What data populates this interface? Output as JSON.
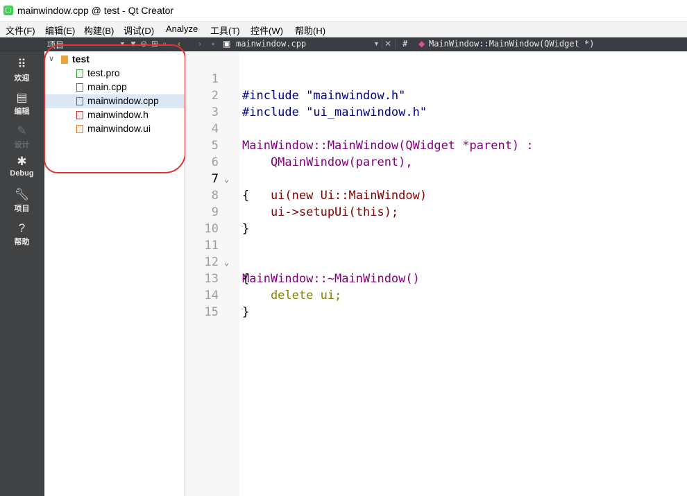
{
  "window": {
    "title": "mainwindow.cpp @ test - Qt Creator"
  },
  "menu": [
    "文件(F)",
    "编辑(E)",
    "构建(B)",
    "调试(D)",
    "Analyze",
    "工具(T)",
    "控件(W)",
    "帮助(H)"
  ],
  "toolbar": {
    "pane_label": "项目",
    "file_name": "mainwindow.cpp",
    "hash": "#",
    "symbol": "MainWindow::MainWindow(QWidget *)"
  },
  "modes": [
    {
      "label": "欢迎",
      "icon": "grid-icon"
    },
    {
      "label": "编辑",
      "icon": "document-icon"
    },
    {
      "label": "设计",
      "icon": "pencil-icon"
    },
    {
      "label": "Debug",
      "icon": "bug-icon"
    },
    {
      "label": "项目",
      "icon": "wrench-icon"
    },
    {
      "label": "帮助",
      "icon": "help-icon"
    }
  ],
  "project_tree": {
    "root": "test",
    "files": [
      "test.pro",
      "main.cpp",
      "mainwindow.cpp",
      "mainwindow.h",
      "mainwindow.ui"
    ],
    "selected": "mainwindow.cpp"
  },
  "editor": {
    "line_numbers": [
      "1",
      "2",
      "3",
      "4",
      "5",
      "6",
      "7",
      "8",
      "9",
      "10",
      "11",
      "12",
      "13",
      "14",
      "15"
    ],
    "current_line": "7",
    "code_lines": [
      "#include \"mainwindow.h\"",
      "#include \"ui_mainwindow.h\"",
      "",
      "MainWindow::MainWindow(QWidget *parent) :",
      "    QMainWindow(parent),",
      "    ui(new Ui::MainWindow)",
      "{",
      "    ui->setupUi(this);",
      "}",
      "",
      "MainWindow::~MainWindow()",
      "{",
      "    delete ui;",
      "}",
      ""
    ]
  },
  "colors": {
    "sidebar": "#404244",
    "toolbar": "#3a3d41",
    "selection": "#dce8f5",
    "annotation": "#e53030"
  }
}
